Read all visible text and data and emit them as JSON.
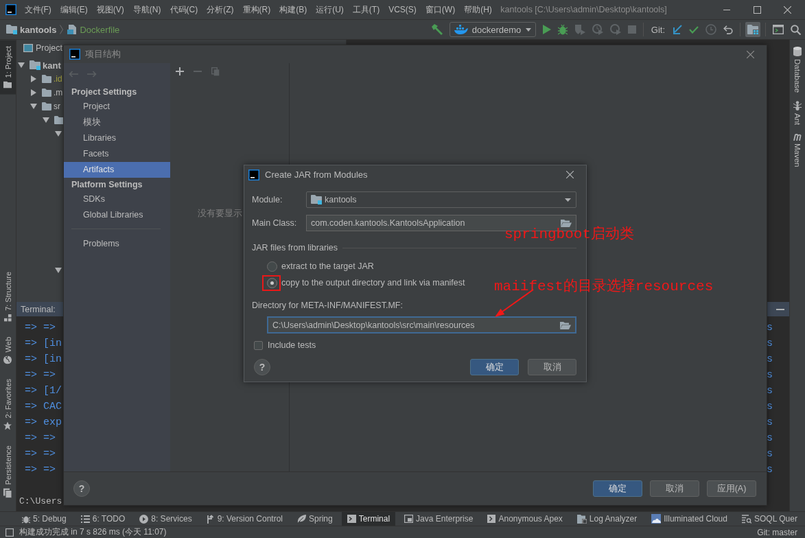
{
  "title_bar": {
    "menus": [
      "文件(F)",
      "编辑(E)",
      "视图(V)",
      "导航(N)",
      "代码(C)",
      "分析(Z)",
      "重构(R)",
      "构建(B)",
      "运行(U)",
      "工具(T)",
      "VCS(S)",
      "窗口(W)",
      "帮助(H)"
    ],
    "title": "kantools [C:\\Users\\admin\\Desktop\\kantools]"
  },
  "nav_bar": {
    "breadcrumbs": [
      {
        "label": "kantools",
        "kind": "project"
      },
      {
        "label": "Dockerfile",
        "kind": "file"
      }
    ],
    "run_config": "dockerdemo",
    "vcs_label": "Git:",
    "structure_pressed": true
  },
  "left_stripe": {
    "top": [
      {
        "label": "1: Project",
        "kind": "project",
        "selected": true
      }
    ],
    "bottom": [
      {
        "label": "7: Structure",
        "kind": "structure",
        "selected": false
      },
      {
        "label": "Web",
        "kind": "web",
        "selected": false
      },
      {
        "label": "2: Favorites",
        "kind": "favorites",
        "selected": false
      },
      {
        "label": "Persistence",
        "kind": "persistence",
        "selected": false
      }
    ]
  },
  "right_stripe": [
    {
      "label": "Database",
      "kind": "database"
    },
    {
      "label": "Ant",
      "kind": "ant"
    },
    {
      "label": "Maven",
      "kind": "maven"
    }
  ],
  "project_panel": {
    "title": "Project",
    "tree": [
      {
        "label": "kant",
        "kind": "module",
        "expanded": true,
        "ignored": false,
        "children": [
          {
            "label": ".id",
            "kind": "folder",
            "expanded": false,
            "ignored": true
          },
          {
            "label": ".m",
            "kind": "folder",
            "expanded": false,
            "ignored": false
          },
          {
            "label": "sr",
            "kind": "folder",
            "expanded": true,
            "ignored": false,
            "children": [
              {
                "kind": "folder",
                "expanded": true,
                "children": [
                  {
                    "expanded": true
                  },
                  {
                    "expanded": true
                  }
                ]
              }
            ]
          }
        ]
      }
    ]
  },
  "terminal": {
    "title": "Terminal:",
    "lines": [
      {
        "text": "=> =>",
        "tail": "s"
      },
      {
        "text": "=> [in",
        "tail": "s"
      },
      {
        "text": "=> [in",
        "tail": "s"
      },
      {
        "text": "=> =>",
        "tail": "s"
      },
      {
        "text": "=> [1/",
        "tail": "s"
      },
      {
        "text": "=> CAC",
        "tail": "s"
      },
      {
        "text": "=> exp",
        "tail": "s"
      },
      {
        "text": "=> =>",
        "tail": "s"
      },
      {
        "text": "=> =>",
        "tail": "s"
      },
      {
        "text": "=> =>",
        "tail": "s"
      }
    ],
    "prompt": "C:\\Users"
  },
  "structure_dialog": {
    "title": "项目结构",
    "history_nav": [
      {
        "kind": "back",
        "disabled": true
      },
      {
        "kind": "forward",
        "disabled": true
      }
    ],
    "sidebar": [
      {
        "kind": "heading",
        "label": "Project Settings"
      },
      {
        "kind": "item",
        "label": "Project",
        "selected": false
      },
      {
        "kind": "item",
        "label": "模块",
        "selected": false
      },
      {
        "kind": "item",
        "label": "Libraries",
        "selected": false
      },
      {
        "kind": "item",
        "label": "Facets",
        "selected": false
      },
      {
        "kind": "item",
        "label": "Artifacts",
        "selected": true
      },
      {
        "kind": "heading",
        "label": "Platform Settings"
      },
      {
        "kind": "item",
        "label": "SDKs",
        "selected": false
      },
      {
        "kind": "item",
        "label": "Global Libraries",
        "selected": false
      },
      {
        "kind": "separator"
      },
      {
        "kind": "item",
        "label": "Problems",
        "selected": false
      }
    ],
    "toolbar": [
      {
        "kind": "add",
        "disabled": false
      },
      {
        "kind": "remove",
        "disabled": true
      },
      {
        "kind": "copy",
        "disabled": true
      }
    ],
    "empty_text": "没有要显示",
    "help": "?",
    "buttons": [
      {
        "label": "确定",
        "primary": true
      },
      {
        "label": "取消",
        "primary": false
      },
      {
        "label": "应用(A)",
        "primary": false
      }
    ]
  },
  "jar_dialog": {
    "title": "Create JAR from Modules",
    "module_label": "Module:",
    "module": "kantools",
    "main_class_label": "Main Class:",
    "main_class": "com.coden.kantools.KantoolsApplication",
    "libraries_heading": "JAR files from libraries",
    "library_options": [
      {
        "label": "extract to the target JAR",
        "selected": false,
        "highlighted": false
      },
      {
        "label": "copy to the output directory and link via manifest",
        "selected": true,
        "highlighted": true
      }
    ],
    "manifest_label": "Directory for META-INF/MANIFEST.MF:",
    "manifest_dir": "C:\\Users\\admin\\Desktop\\kantools\\src\\main\\resources",
    "manifest_focused": true,
    "include_tests": {
      "label": "Include tests",
      "checked": false
    },
    "help": "?",
    "buttons": [
      {
        "label": "确定",
        "primary": true
      },
      {
        "label": "取消",
        "primary": false
      }
    ]
  },
  "annotations": [
    {
      "text": "springboot启动类",
      "arrow": false
    },
    {
      "text": "maiifest的目录选择resources",
      "arrow": true
    }
  ],
  "bottom_tools": [
    {
      "label": "5: Debug",
      "kind": "debug",
      "selected": false
    },
    {
      "label": "6: TODO",
      "kind": "todo",
      "selected": false
    },
    {
      "label": "8: Services",
      "kind": "services",
      "selected": false
    },
    {
      "label": "9: Version Control",
      "kind": "vcs",
      "selected": false
    },
    {
      "label": "Spring",
      "kind": "spring",
      "selected": false
    },
    {
      "label": "Terminal",
      "kind": "terminal",
      "selected": true
    },
    {
      "label": "Java Enterprise",
      "kind": "javaee",
      "selected": false
    },
    {
      "label": "Anonymous Apex",
      "kind": "apex",
      "selected": false
    },
    {
      "label": "Log Analyzer",
      "kind": "log",
      "selected": false
    },
    {
      "label": "Illuminated Cloud",
      "kind": "cloud",
      "selected": false
    },
    {
      "label": "SOQL Quer",
      "kind": "soql",
      "selected": false
    }
  ],
  "status_bar": {
    "message": "构建成功完成 in 7 s 826 ms (今天 11:07)",
    "vcs": "Git: master"
  }
}
